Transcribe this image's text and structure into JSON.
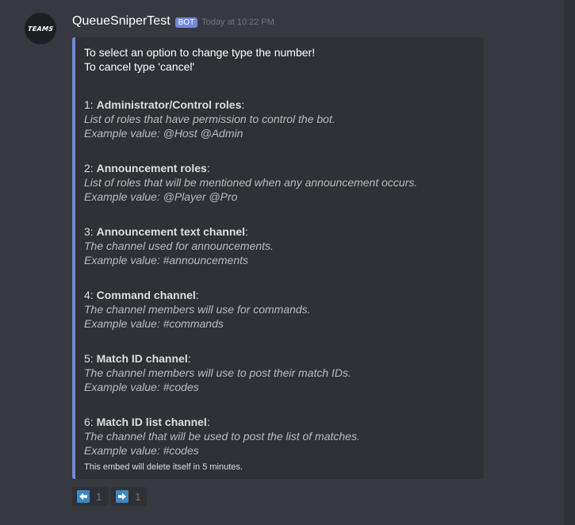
{
  "avatar": {
    "text": "TEAMS"
  },
  "message": {
    "username": "QueueSniperTest",
    "bot_tag": "BOT",
    "timestamp": "Today at 10:22 PM"
  },
  "embed": {
    "color": "#7289da",
    "intro_line1": "To select an option to change type the number!",
    "intro_line2": "To cancel type 'cancel'",
    "options": [
      {
        "number": "1: ",
        "title": "Administrator/Control roles",
        "suffix": ":",
        "description": "List of roles that have permission to control the bot.",
        "example": "Example value: @Host @Admin"
      },
      {
        "number": "2: ",
        "title": "Announcement roles",
        "suffix": ":",
        "description": "List of roles that will be mentioned when any announcement occurs.",
        "example": "Example value: @Player @Pro"
      },
      {
        "number": "3: ",
        "title": "Announcement text channel",
        "suffix": ":",
        "description": "The channel used for announcements.",
        "example": "Example value: #announcements"
      },
      {
        "number": "4: ",
        "title": "Command channel",
        "suffix": ":",
        "description": "The channel members will use for commands.",
        "example": "Example value: #commands"
      },
      {
        "number": "5: ",
        "title": "Match ID channel",
        "suffix": ":",
        "description": "The channel members will use to post their match IDs.",
        "example": "Example value: #codes"
      },
      {
        "number": "6: ",
        "title": "Match ID list channel",
        "suffix": ":",
        "description": "The channel that will be used to post the list of matches.",
        "example": "Example value: #codes"
      }
    ],
    "footer": "This embed will delete itself in 5 minutes."
  },
  "reactions": [
    {
      "icon": "arrow-left-icon",
      "count": "1"
    },
    {
      "icon": "arrow-right-icon",
      "count": "1"
    }
  ]
}
